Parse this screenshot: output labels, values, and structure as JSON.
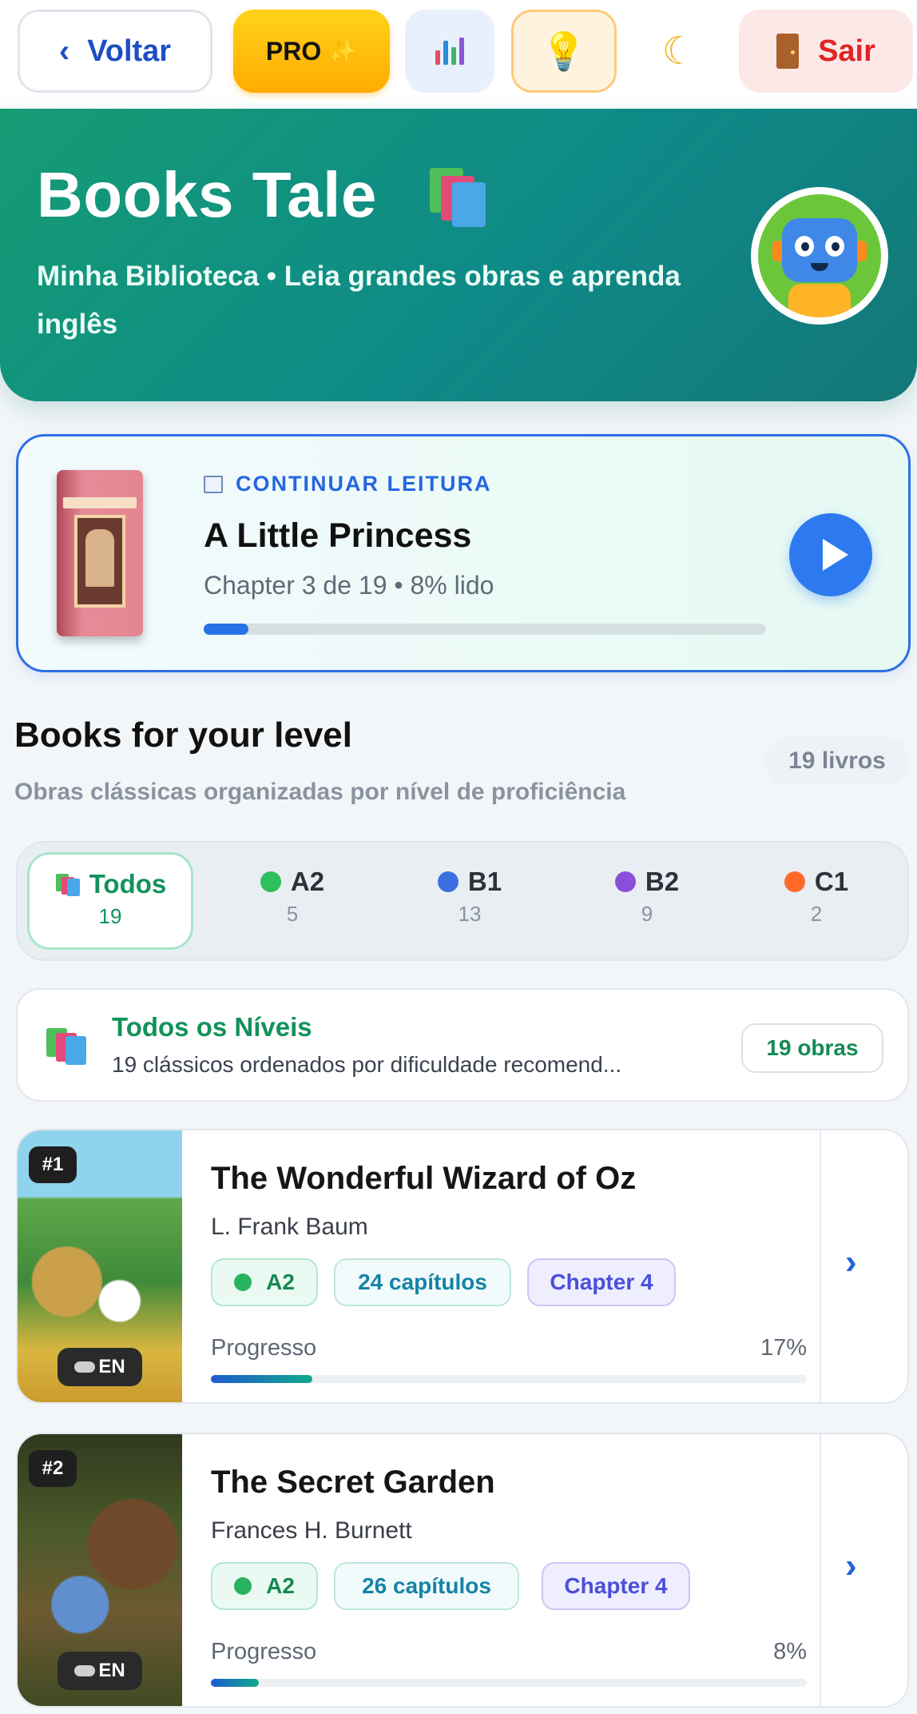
{
  "topbar": {
    "back_label": "Voltar",
    "pro_label": "PRO",
    "pro_sparkle": "✨",
    "moon_icon": "☾",
    "bulb_icon": "💡",
    "exit_label": "Sair"
  },
  "hero": {
    "title": "Books Tale",
    "subtitle": "Minha Biblioteca • Leia grandes obras e aprenda inglês"
  },
  "continue_reading": {
    "label": "CONTINUAR LEITURA",
    "title": "A Little Princess",
    "meta": "Chapter 3 de 19 • 8% lido",
    "progress_pct": 8
  },
  "section": {
    "title": "Books for your level",
    "subtitle": "Obras clássicas organizadas por nível de proficiência",
    "count": "19 livros"
  },
  "levels": [
    {
      "label": "Todos",
      "count": "19",
      "active": true,
      "color": "#13925c"
    },
    {
      "label": "A2",
      "count": "5",
      "active": false,
      "color": "#2fbf5f"
    },
    {
      "label": "B1",
      "count": "13",
      "active": false,
      "color": "#3e6fe0"
    },
    {
      "label": "B2",
      "count": "9",
      "active": false,
      "color": "#8a4fd8"
    },
    {
      "label": "C1",
      "count": "2",
      "active": false,
      "color": "#ff6a2b"
    }
  ],
  "all_levels": {
    "title": "Todos os Níveis",
    "subtitle": "19 clássicos ordenados por dificuldade recomend...",
    "pill": "19 obras"
  },
  "books": [
    {
      "rank": "#1",
      "lang": "EN",
      "title": "The Wonderful Wizard of Oz",
      "author": "L. Frank Baum",
      "level": "A2",
      "chapters": "24 capítulos",
      "current": "Chapter 4",
      "progress_label": "Progresso",
      "progress_text": "17%",
      "progress_pct": 17
    },
    {
      "rank": "#2",
      "lang": "EN",
      "title": "The Secret Garden",
      "author": "Frances H. Burnett",
      "level": "A2",
      "chapters": "26 capítulos",
      "current": "Chapter 4",
      "progress_label": "Progresso",
      "progress_text": "8%",
      "progress_pct": 8
    }
  ],
  "colors": {
    "brand_green": "#159c74",
    "accent_blue": "#2d7af0",
    "exit_red": "#e02424"
  }
}
